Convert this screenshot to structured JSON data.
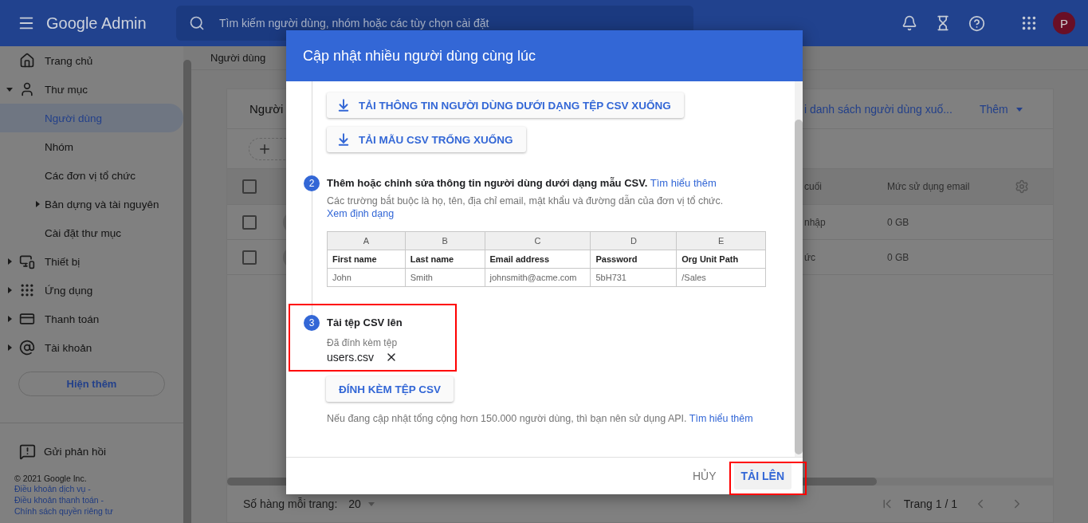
{
  "top_bar": {
    "app_name": "Google Admin",
    "search": {
      "placeholder": "Tìm kiếm người dùng, nhóm hoặc các tùy chọn cài đặt"
    },
    "avatar": "P"
  },
  "sidebar": {
    "items": [
      {
        "label": "Trang chủ",
        "kind": "link",
        "selected": false
      },
      {
        "label": "Thư mục",
        "kind": "group",
        "expanded": true,
        "selected": false,
        "children": [
          {
            "label": "Người dùng",
            "kind": "link",
            "selected": true
          },
          {
            "label": "Nhóm",
            "kind": "link",
            "selected": false
          },
          {
            "label": "Các đơn vị tổ chức",
            "kind": "link",
            "selected": false
          },
          {
            "label": "Bản dựng và tài nguyên",
            "kind": "group",
            "expanded": false,
            "selected": false
          },
          {
            "label": "Cài đặt thư mục",
            "kind": "link",
            "selected": false
          }
        ]
      },
      {
        "label": "Thiết bị",
        "kind": "group",
        "expanded": false,
        "selected": false
      },
      {
        "label": "Ứng dụng",
        "kind": "group",
        "expanded": false,
        "selected": false
      },
      {
        "label": "Thanh toán",
        "kind": "group",
        "expanded": false,
        "selected": false
      },
      {
        "label": "Tài khoản",
        "kind": "group",
        "expanded": false,
        "selected": false
      }
    ],
    "more_button": "Hiện thêm",
    "feedback": "Gửi phản hồi",
    "copyright": "© 2021 Google Inc.",
    "link_separator": "-",
    "footer_links": [
      "Điều khoản dịch vụ",
      "Điều khoản thanh toán",
      "Chính sách quyền riêng tư"
    ]
  },
  "breadcrumb": "Người dùng",
  "users_card": {
    "title": "Người",
    "download_link": "i danh sách người dùng xuố...",
    "more_menu": "Thêm",
    "header_checkbox": {
      "checked": false
    },
    "columns": [
      "cuối",
      "Mức sử dụng email"
    ],
    "rows": [
      {
        "checked": false,
        "column_2": "nhập",
        "column_3": "0 GB"
      },
      {
        "checked": false,
        "column_2": "ức",
        "column_3": "0 GB"
      }
    ],
    "rows_per_page_label": "Số hàng mỗi trang:",
    "rows_per_page": "20",
    "page_label": "Trang 1 / 1"
  },
  "dialog": {
    "title": "Cập nhật nhiều người dùng cùng lúc",
    "download_buttons": [
      "TẢI THÔNG TIN NGƯỜI DÙNG DƯỚI DẠNG TỆP CSV XUỐNG",
      "TẢI MẪU CSV TRỐNG XUỐNG"
    ],
    "step_2": {
      "number": "2",
      "title": "Thêm hoặc chỉnh sửa thông tin người dùng dưới dạng mẫu CSV.",
      "title_link": "Tìm hiểu thêm",
      "hint": "Các trường bắt buộc là họ, tên, địa chỉ email, mật khẩu và đường dẫn của đơn vị tổ chức.",
      "hint_link": "Xem định dạng",
      "sample_table": {
        "column_letters": [
          "A",
          "B",
          "C",
          "D",
          "E"
        ],
        "rows": [
          [
            "First name",
            "Last name",
            "Email address",
            "Password",
            "Org Unit Path"
          ],
          [
            "John",
            "Smith",
            "johnsmith@acme.com",
            "5bH731",
            "/Sales"
          ]
        ]
      }
    },
    "step_3": {
      "number": "3",
      "title": "Tải tệp CSV lên",
      "attached_label": "Đã đính kèm tệp",
      "file_name": "users.csv",
      "attach_button": "ĐÍNH KÈM TỆP CSV",
      "note": "Nếu đang cập nhật tổng cộng hơn 150.000 người dùng, thì bạn nên sử dụng API.",
      "note_link": "Tìm hiểu thêm"
    },
    "cancel_button": "HỦY",
    "upload_button": "TẢI LÊN"
  }
}
